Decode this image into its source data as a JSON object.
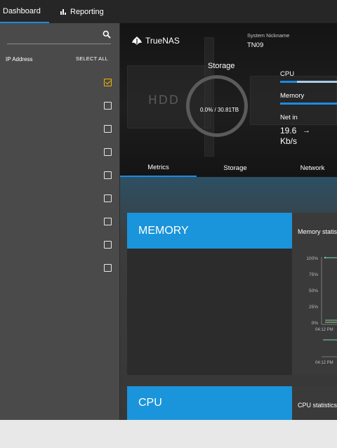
{
  "nav": {
    "tabs": [
      {
        "label": "Dashboard",
        "active": true
      },
      {
        "label": "Reporting",
        "active": false
      }
    ]
  },
  "sidebar": {
    "column_header": "IP Address",
    "select_all": "SELECT ALL",
    "rows": [
      {
        "checked": true
      },
      {
        "checked": false
      },
      {
        "checked": false
      },
      {
        "checked": false
      },
      {
        "checked": false
      },
      {
        "checked": false
      },
      {
        "checked": false
      },
      {
        "checked": false
      },
      {
        "checked": false
      }
    ]
  },
  "system": {
    "brand": "TrueNAS",
    "nickname_label": "System Nickname",
    "nickname": "TN09",
    "hdd_label": "HDD",
    "storage_title": "Storage",
    "storage_usage": "0.0% / 30.81TB",
    "metrics": {
      "cpu_label": "CPU",
      "cpu_fraction": 0.3,
      "memory_label": "Memory",
      "memory_fraction": 1.0,
      "net_label": "Net in",
      "net_value": "19.6",
      "net_unit": "Kb/s"
    },
    "tabs": [
      "Metrics",
      "Storage",
      "Network"
    ],
    "active_tab": "Metrics"
  },
  "cards": {
    "memory": {
      "title": "MEMORY",
      "subtitle": "Memory statis",
      "yticks": [
        "100%",
        "75%",
        "50%",
        "25%",
        "0%"
      ],
      "time_label": "04:12 PM"
    },
    "cpu": {
      "title": "CPU",
      "subtitle": "CPU statistics"
    }
  },
  "colors": {
    "accent": "#1c8be0",
    "card_header": "#1a94da",
    "checkbox_checked": "#f5b400",
    "series": "#7fd4b0"
  }
}
